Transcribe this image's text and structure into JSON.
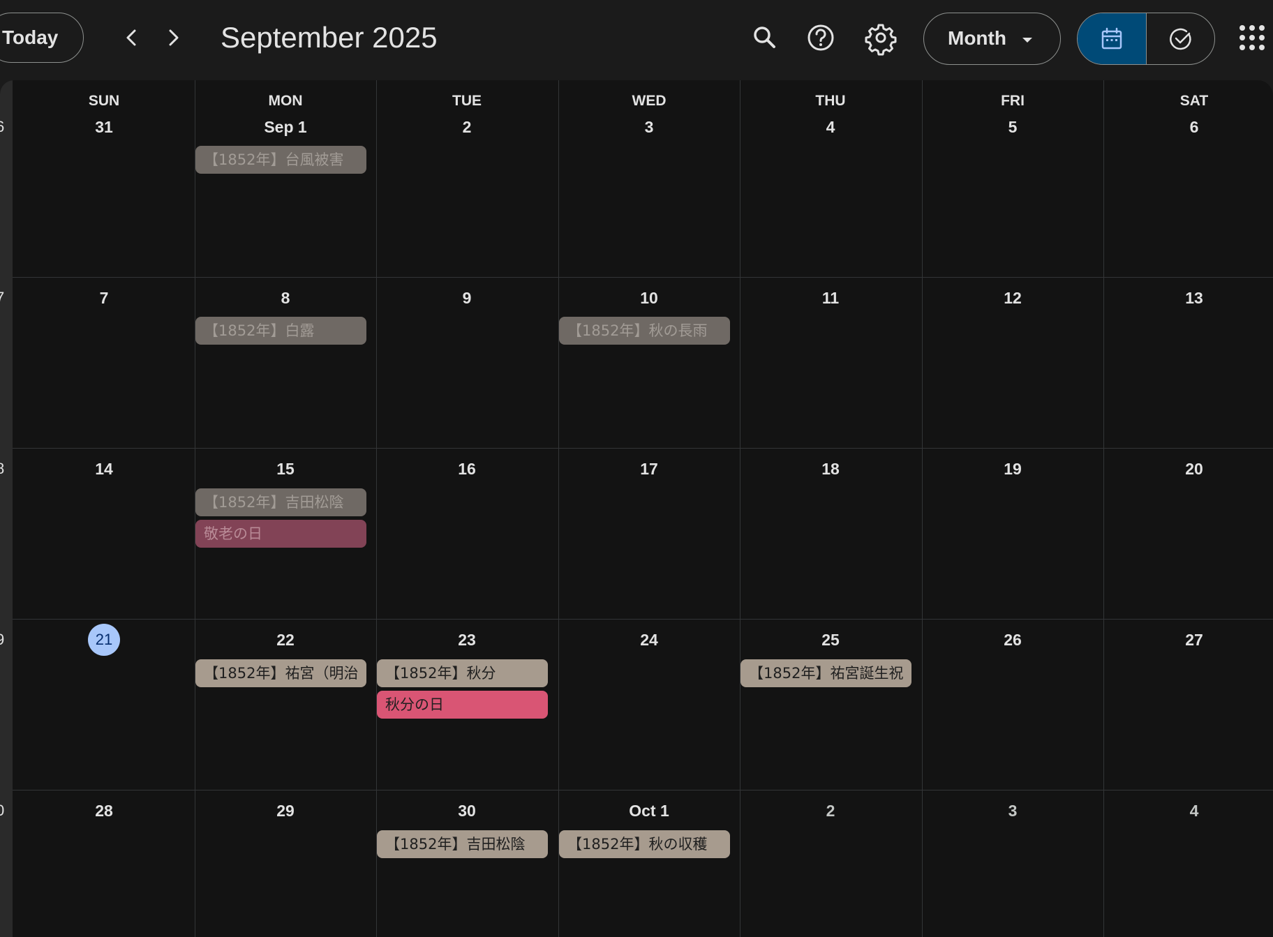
{
  "toolbar": {
    "today_label": "Today",
    "prev_icon": "chevron-left-icon",
    "next_icon": "chevron-right-icon",
    "title": "September 2025",
    "view_label": "Month"
  },
  "colors": {
    "background": "#1b1b1b",
    "grid": "#131313",
    "accent": "#004a77",
    "today": "#a8c7fa",
    "chip_past": "#6f6964",
    "chip_current": "#a79b8e",
    "holiday_past": "#824356",
    "holiday_current": "#d95574"
  },
  "weekdays": [
    "SUN",
    "MON",
    "TUE",
    "WED",
    "THU",
    "FRI",
    "SAT"
  ],
  "week_numbers": [
    "6",
    "7",
    "8",
    "9",
    "0"
  ],
  "weeks": [
    [
      "31",
      "Sep 1",
      "2",
      "3",
      "4",
      "5",
      "6"
    ],
    [
      "7",
      "8",
      "9",
      "10",
      "11",
      "12",
      "13"
    ],
    [
      "14",
      "15",
      "16",
      "17",
      "18",
      "19",
      "20"
    ],
    [
      "21",
      "22",
      "23",
      "24",
      "25",
      "26",
      "27"
    ],
    [
      "28",
      "29",
      "30",
      "Oct 1",
      "2",
      "3",
      "4"
    ]
  ],
  "events": {
    "w0_mon": "【1852年】台風被害",
    "w1_mon": "【1852年】白露",
    "w1_wed": "【1852年】秋の長雨",
    "w2_mon_1": "【1852年】吉田松陰",
    "w2_mon_2": "敬老の日",
    "w3_mon": "【1852年】祐宮（明治",
    "w3_tue_1": "【1852年】秋分",
    "w3_tue_2": "秋分の日",
    "w3_thu": "【1852年】祐宮誕生祝",
    "w4_tue": "【1852年】吉田松陰",
    "w4_wed": "【1852年】秋の収穫"
  }
}
